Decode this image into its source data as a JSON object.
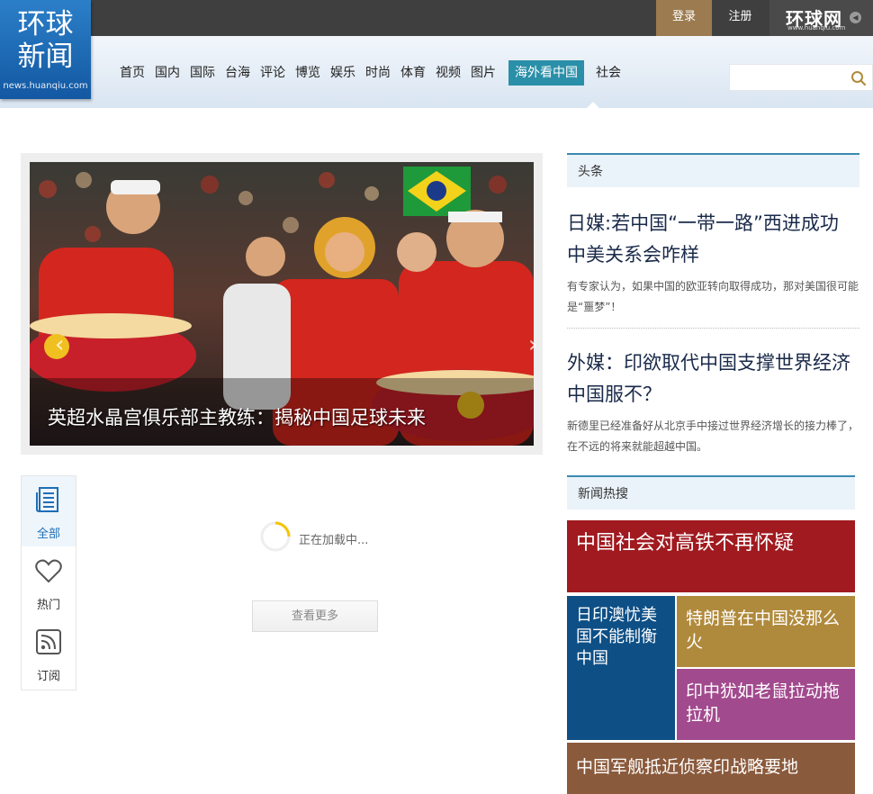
{
  "topbar": {
    "login": "登录",
    "register": "注册",
    "brand_name": "环球网",
    "brand_url": "www.huanqiu.com"
  },
  "logo": {
    "line1": "环球",
    "line2": "新闻",
    "url": "news.huanqiu.com"
  },
  "nav": {
    "items": [
      "首页",
      "国内",
      "国际",
      "台海",
      "评论",
      "博览",
      "娱乐",
      "时尚",
      "体育",
      "视频",
      "图片",
      "海外看中国",
      "社会"
    ],
    "active_index": 11
  },
  "search": {
    "placeholder": "",
    "icon": "search-icon"
  },
  "slider": {
    "caption": "英超水晶宫俱乐部主教练：揭秘中国足球未来"
  },
  "tabs": [
    {
      "label": "全部",
      "icon": "newspaper-icon"
    },
    {
      "label": "热门",
      "icon": "heart-icon"
    },
    {
      "label": "订阅",
      "icon": "rss-icon"
    }
  ],
  "feed": {
    "loading_text": "正在加载中...",
    "more_button": "查看更多"
  },
  "headlines": {
    "section_title": "头条",
    "items": [
      {
        "title": "日媒:若中国“一带一路”西进成功 中美关系会咋样",
        "desc": "有专家认为，如果中国的欧亚转向取得成功，那对美国很可能是“噩梦”！"
      },
      {
        "title": "外媒：印欲取代中国支撑世界经济 中国服不？",
        "desc": "新德里已经准备好从北京手中接过世界经济增长的接力棒了，在不远的将来就能超越中国。"
      }
    ]
  },
  "hot_search": {
    "section_title": "新闻热搜",
    "items": [
      {
        "text": "中国社会对高铁不再怀疑",
        "color": "#a01a1f"
      },
      {
        "text": "日印澳忧美国不能制衡中国",
        "color": "#0e4f86"
      },
      {
        "text": "特朗普在中国没那么火",
        "color": "#b08a3c"
      },
      {
        "text": "印中犹如老鼠拉动拖拉机",
        "color": "#a24a8e"
      },
      {
        "text": "中国军舰抵近侦察印战略要地",
        "color": "#8a5a3c"
      }
    ]
  }
}
